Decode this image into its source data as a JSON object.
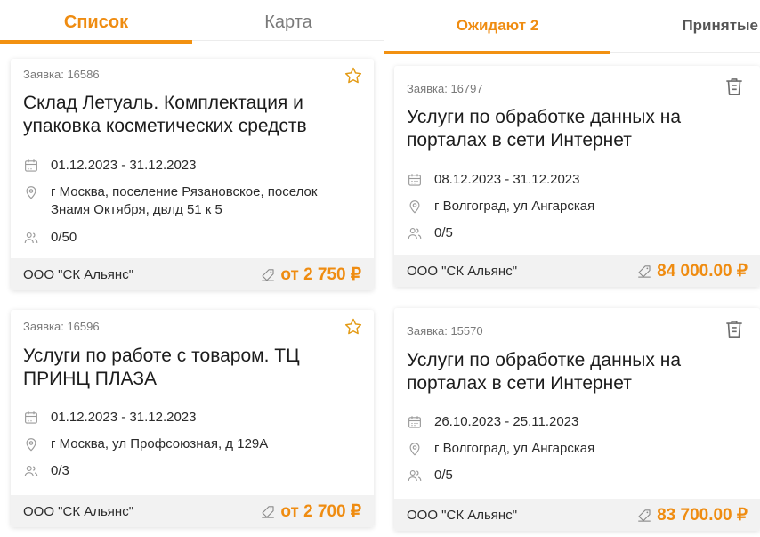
{
  "left": {
    "tabs": [
      "Список",
      "Карта"
    ],
    "cards": [
      {
        "number": "Заявка: 16586",
        "title": "Склад Летуаль. Комплектация и упаковка косметических средств",
        "dates": "01.12.2023 - 31.12.2023",
        "address": "г Москва, поселение Рязановское, поселок Знамя Октября, двлд 51 к 5",
        "people": "0/50",
        "org": "ООО \"СК Альянс\"",
        "price": "от 2 750 ₽"
      },
      {
        "number": "Заявка: 16596",
        "title": "Услуги по работе с товаром. ТЦ ПРИНЦ ПЛАЗА",
        "dates": "01.12.2023 - 31.12.2023",
        "address": "г Москва, ул Профсоюзная, д 129А",
        "people": "0/3",
        "org": "ООО \"СК Альянс\"",
        "price": "от 2 700 ₽"
      }
    ]
  },
  "right": {
    "tabs": [
      "Ожидают 2",
      "Принятые"
    ],
    "cards": [
      {
        "number": "Заявка: 16797",
        "title": "Услуги по обработке данных на порталах в сети Интернет",
        "dates": "08.12.2023 - 31.12.2023",
        "address": "г Волгоград, ул Ангарская",
        "people": "0/5",
        "org": "ООО \"СК Альянс\"",
        "price": "84 000.00 ₽"
      },
      {
        "number": "Заявка: 15570",
        "title": "Услуги по обработке данных на порталах в сети Интернет",
        "dates": "26.10.2023 - 25.11.2023",
        "address": "г Волгоград, ул Ангарская",
        "people": "0/5",
        "org": "ООО \"СК Альянс\"",
        "price": "83 700.00 ₽"
      }
    ]
  },
  "colors": {
    "accent": "#ef8c11",
    "footer_bg": "#f2f2f2",
    "muted": "#7a7a7a"
  },
  "icons": [
    "star-icon",
    "trash-icon",
    "calendar-icon",
    "location-pin-icon",
    "people-icon",
    "price-tag-icon"
  ]
}
